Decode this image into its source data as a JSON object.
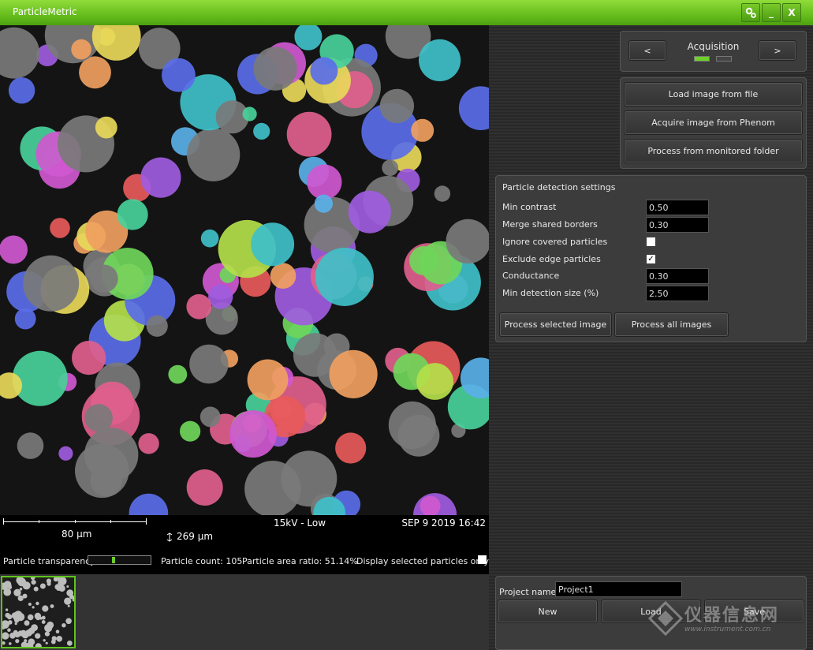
{
  "window": {
    "title": "ParticleMetric",
    "minimize_label": "_",
    "close_label": "X",
    "settings_icon": "gears-icon"
  },
  "scalebar": {
    "label": "80 µm",
    "hfw": "269 µm",
    "hfw_icon": "field-width-icon",
    "beam": "15kV - Low",
    "datetime": "SEP 9 2019 16:42"
  },
  "options": {
    "transparency_label": "Particle transparency",
    "transparency_value": 0.4,
    "count_text": "Particle count: 105",
    "area_ratio_text": "Particle area ratio: 51.14%",
    "display_selected_label": "Display selected particles only",
    "display_selected_checked": false
  },
  "acquisition": {
    "title": "Acquisition",
    "prev_label": "<",
    "next_label": ">",
    "step_indicators": [
      true,
      false
    ]
  },
  "image_source": {
    "load_file_label": "Load image from file",
    "acquire_label": "Acquire image from Phenom",
    "monitored_label": "Process from monitored folder"
  },
  "detection": {
    "title": "Particle detection settings",
    "min_contrast": {
      "label": "Min contrast",
      "value": "0.50"
    },
    "merge_borders": {
      "label": "Merge shared borders",
      "value": "0.30"
    },
    "ignore_covered": {
      "label": "Ignore covered particles",
      "checked": false
    },
    "exclude_edge": {
      "label": "Exclude edge particles",
      "checked": true
    },
    "conductance": {
      "label": "Conductance",
      "value": "0.30"
    },
    "min_size": {
      "label": "Min detection size (%)",
      "value": "2.50"
    },
    "process_selected_label": "Process selected image",
    "process_all_label": "Process all images"
  },
  "project": {
    "label": "Project name",
    "name": "Project1",
    "new_label": "New",
    "load_label": "Load",
    "save_label": "Save"
  },
  "watermark": {
    "text": "仪器信息网",
    "url": "www.instrument.com.cn"
  },
  "colors": {
    "accent": "#5fb818",
    "particle_palette": [
      "#6fd65a",
      "#a05ce0",
      "#e0608c",
      "#3fc0c8",
      "#f0a060",
      "#e8d85a",
      "#5a6ee8",
      "#e85a5a",
      "#5ab0e8",
      "#b4e04a",
      "#d058d0",
      "#48d09a"
    ],
    "unselected": "#7a7a7a"
  }
}
